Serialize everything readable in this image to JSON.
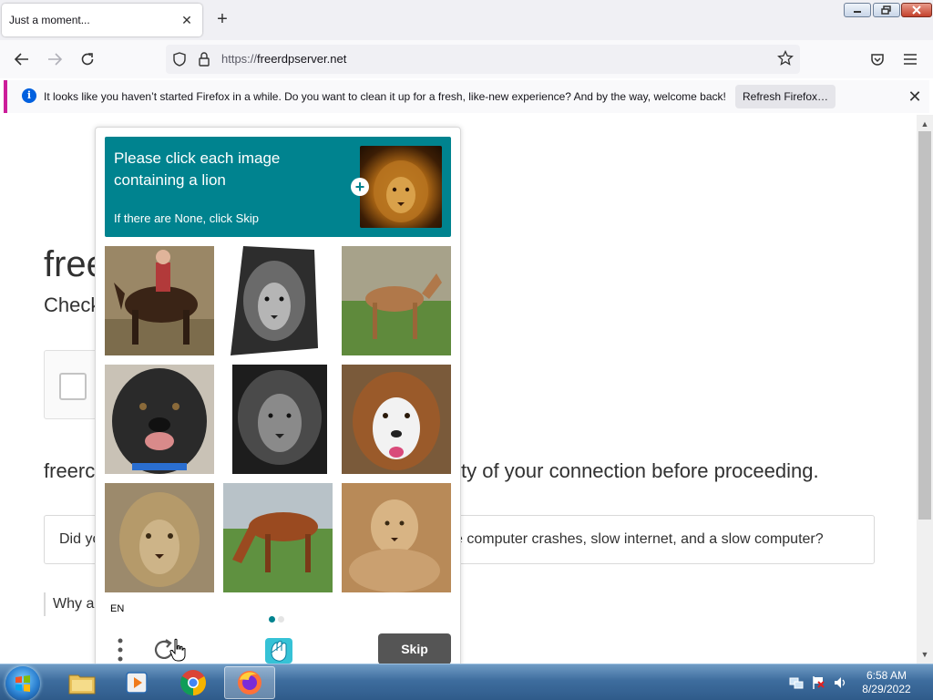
{
  "browser": {
    "tab_title": "Just a moment...",
    "url_scheme": "https://",
    "url_host": "freerdpserver.net",
    "notification_text": "It looks like you haven’t started Firefox in a while. Do you want to clean it up for a fresh, like-new experience? And by the way, welcome back!",
    "refresh_button_label": "Refresh Firefox…",
    "notification_accent": "#cc1e9a"
  },
  "page": {
    "heading_partial": "free",
    "subheading_partial": "Check",
    "checking_text_start": "freerc",
    "checking_text_end": "ty of your connection before proceeding.",
    "ad_text_start": "Did yo",
    "ad_text_end": "e computer crashes, slow internet, and a slow computer?",
    "why_text_partial": "Why a"
  },
  "captcha": {
    "prompt": "Please click each image containing a lion",
    "hint": "If there are None, click Skip",
    "example_image": "lion",
    "header_color": "#00838f",
    "language": "EN",
    "skip_label": "Skip",
    "page_dots": [
      true,
      false
    ],
    "tiles": [
      {
        "subject": "child riding a dark horse"
      },
      {
        "subject": "lion head, black and white"
      },
      {
        "subject": "foal on grass"
      },
      {
        "subject": "black dog"
      },
      {
        "subject": "grey lion"
      },
      {
        "subject": "brown and white dog"
      },
      {
        "subject": "lioness face"
      },
      {
        "subject": "brown horse grazing"
      },
      {
        "subject": "lioness lying down"
      }
    ]
  },
  "taskbar": {
    "apps": [
      "file-explorer",
      "media-player",
      "chrome",
      "firefox"
    ],
    "active_app": "firefox",
    "time": "6:58 AM",
    "date": "8/29/2022"
  }
}
